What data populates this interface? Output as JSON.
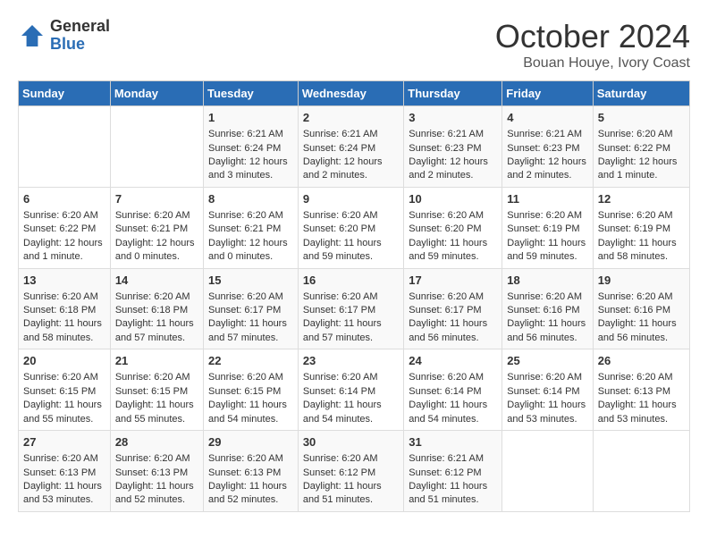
{
  "logo": {
    "general": "General",
    "blue": "Blue"
  },
  "title": "October 2024",
  "subtitle": "Bouan Houye, Ivory Coast",
  "days_of_week": [
    "Sunday",
    "Monday",
    "Tuesday",
    "Wednesday",
    "Thursday",
    "Friday",
    "Saturday"
  ],
  "weeks": [
    [
      {
        "day": "",
        "content": ""
      },
      {
        "day": "",
        "content": ""
      },
      {
        "day": "1",
        "content": "Sunrise: 6:21 AM\nSunset: 6:24 PM\nDaylight: 12 hours and 3 minutes."
      },
      {
        "day": "2",
        "content": "Sunrise: 6:21 AM\nSunset: 6:24 PM\nDaylight: 12 hours and 2 minutes."
      },
      {
        "day": "3",
        "content": "Sunrise: 6:21 AM\nSunset: 6:23 PM\nDaylight: 12 hours and 2 minutes."
      },
      {
        "day": "4",
        "content": "Sunrise: 6:21 AM\nSunset: 6:23 PM\nDaylight: 12 hours and 2 minutes."
      },
      {
        "day": "5",
        "content": "Sunrise: 6:20 AM\nSunset: 6:22 PM\nDaylight: 12 hours and 1 minute."
      }
    ],
    [
      {
        "day": "6",
        "content": "Sunrise: 6:20 AM\nSunset: 6:22 PM\nDaylight: 12 hours and 1 minute."
      },
      {
        "day": "7",
        "content": "Sunrise: 6:20 AM\nSunset: 6:21 PM\nDaylight: 12 hours and 0 minutes."
      },
      {
        "day": "8",
        "content": "Sunrise: 6:20 AM\nSunset: 6:21 PM\nDaylight: 12 hours and 0 minutes."
      },
      {
        "day": "9",
        "content": "Sunrise: 6:20 AM\nSunset: 6:20 PM\nDaylight: 11 hours and 59 minutes."
      },
      {
        "day": "10",
        "content": "Sunrise: 6:20 AM\nSunset: 6:20 PM\nDaylight: 11 hours and 59 minutes."
      },
      {
        "day": "11",
        "content": "Sunrise: 6:20 AM\nSunset: 6:19 PM\nDaylight: 11 hours and 59 minutes."
      },
      {
        "day": "12",
        "content": "Sunrise: 6:20 AM\nSunset: 6:19 PM\nDaylight: 11 hours and 58 minutes."
      }
    ],
    [
      {
        "day": "13",
        "content": "Sunrise: 6:20 AM\nSunset: 6:18 PM\nDaylight: 11 hours and 58 minutes."
      },
      {
        "day": "14",
        "content": "Sunrise: 6:20 AM\nSunset: 6:18 PM\nDaylight: 11 hours and 57 minutes."
      },
      {
        "day": "15",
        "content": "Sunrise: 6:20 AM\nSunset: 6:17 PM\nDaylight: 11 hours and 57 minutes."
      },
      {
        "day": "16",
        "content": "Sunrise: 6:20 AM\nSunset: 6:17 PM\nDaylight: 11 hours and 57 minutes."
      },
      {
        "day": "17",
        "content": "Sunrise: 6:20 AM\nSunset: 6:17 PM\nDaylight: 11 hours and 56 minutes."
      },
      {
        "day": "18",
        "content": "Sunrise: 6:20 AM\nSunset: 6:16 PM\nDaylight: 11 hours and 56 minutes."
      },
      {
        "day": "19",
        "content": "Sunrise: 6:20 AM\nSunset: 6:16 PM\nDaylight: 11 hours and 56 minutes."
      }
    ],
    [
      {
        "day": "20",
        "content": "Sunrise: 6:20 AM\nSunset: 6:15 PM\nDaylight: 11 hours and 55 minutes."
      },
      {
        "day": "21",
        "content": "Sunrise: 6:20 AM\nSunset: 6:15 PM\nDaylight: 11 hours and 55 minutes."
      },
      {
        "day": "22",
        "content": "Sunrise: 6:20 AM\nSunset: 6:15 PM\nDaylight: 11 hours and 54 minutes."
      },
      {
        "day": "23",
        "content": "Sunrise: 6:20 AM\nSunset: 6:14 PM\nDaylight: 11 hours and 54 minutes."
      },
      {
        "day": "24",
        "content": "Sunrise: 6:20 AM\nSunset: 6:14 PM\nDaylight: 11 hours and 54 minutes."
      },
      {
        "day": "25",
        "content": "Sunrise: 6:20 AM\nSunset: 6:14 PM\nDaylight: 11 hours and 53 minutes."
      },
      {
        "day": "26",
        "content": "Sunrise: 6:20 AM\nSunset: 6:13 PM\nDaylight: 11 hours and 53 minutes."
      }
    ],
    [
      {
        "day": "27",
        "content": "Sunrise: 6:20 AM\nSunset: 6:13 PM\nDaylight: 11 hours and 53 minutes."
      },
      {
        "day": "28",
        "content": "Sunrise: 6:20 AM\nSunset: 6:13 PM\nDaylight: 11 hours and 52 minutes."
      },
      {
        "day": "29",
        "content": "Sunrise: 6:20 AM\nSunset: 6:13 PM\nDaylight: 11 hours and 52 minutes."
      },
      {
        "day": "30",
        "content": "Sunrise: 6:20 AM\nSunset: 6:12 PM\nDaylight: 11 hours and 51 minutes."
      },
      {
        "day": "31",
        "content": "Sunrise: 6:21 AM\nSunset: 6:12 PM\nDaylight: 11 hours and 51 minutes."
      },
      {
        "day": "",
        "content": ""
      },
      {
        "day": "",
        "content": ""
      }
    ]
  ]
}
